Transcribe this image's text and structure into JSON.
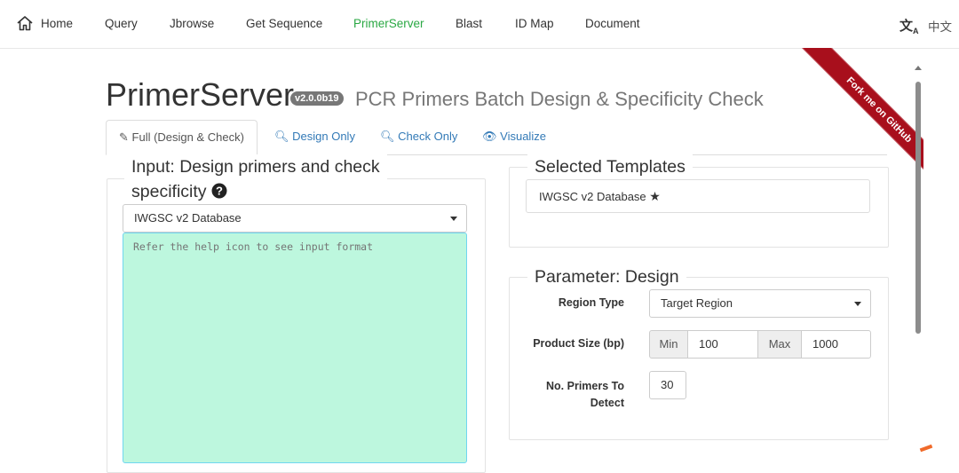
{
  "nav": {
    "home": "Home",
    "items": [
      "Query",
      "Jbrowse",
      "Get Sequence",
      "PrimerServer",
      "Blast",
      "ID Map",
      "Document"
    ],
    "active": "PrimerServer",
    "lang_icon": "translate-icon",
    "lang": "中文"
  },
  "header": {
    "title": "PrimerServer",
    "version": "v2.0.0b19",
    "subtitle": "PCR Primers Batch Design & Specificity Check"
  },
  "ribbon": {
    "text": "Fork me on GitHub"
  },
  "tabs": [
    {
      "label": "Full (Design & Check)",
      "icon": "edit-icon",
      "active": true
    },
    {
      "label": "Design Only",
      "icon": "search-icon"
    },
    {
      "label": "Check Only",
      "icon": "search-icon"
    },
    {
      "label": "Visualize",
      "icon": "eye-icon"
    }
  ],
  "input_panel": {
    "legend_line1": "Input: Design primers and check",
    "legend_line2": "specificity",
    "help_icon": "question-circle-icon",
    "database": "IWGSC v2 Database",
    "textarea_placeholder": "Refer the help icon to see input format"
  },
  "templates_panel": {
    "legend": "Selected Templates",
    "item": "IWGSC v2 Database",
    "item_icon": "star-icon"
  },
  "design_panel": {
    "legend": "Parameter: Design",
    "region_type_label": "Region Type",
    "region_type_value": "Target Region",
    "product_size_label": "Product Size (bp)",
    "min_label": "Min",
    "min_value": "100",
    "max_label": "Max",
    "max_value": "1000",
    "num_primers_label_1": "No. Primers To",
    "num_primers_label_2": "Detect",
    "num_primers_value": "30"
  },
  "colors": {
    "nav_active": "#2aa843",
    "link": "#337ab7",
    "textarea_bg": "#bdf7de",
    "ribbon": "#a80f1c"
  }
}
